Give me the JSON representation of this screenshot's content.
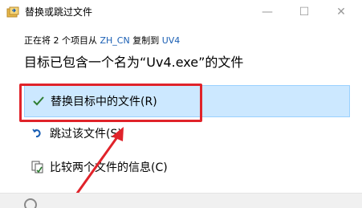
{
  "window": {
    "title": "替换或跳过文件",
    "min_symbol": "—",
    "max_symbol": "☐",
    "close_symbol": "✕"
  },
  "status": {
    "prefix": "正在将 2 个项目从 ",
    "source": "ZH_CN",
    "middle": " 复制到 ",
    "dest": "UV4"
  },
  "headline": "目标已包含一个名为“Uv4.exe”的文件",
  "options": [
    {
      "label": "替换目标中的文件(R)",
      "icon": "check-icon",
      "selected": true
    },
    {
      "label": "跳过该文件(S)",
      "icon": "skip-icon",
      "selected": false
    },
    {
      "label": "比较两个文件的信息(C)",
      "icon": "compare-icon",
      "selected": false
    }
  ],
  "colors": {
    "selected_bg": "#cce8ff",
    "selected_border": "#99d1ff",
    "annotation_red": "#e0232a",
    "link_blue": "#1a5fb4",
    "check_green": "#2e7d32"
  }
}
